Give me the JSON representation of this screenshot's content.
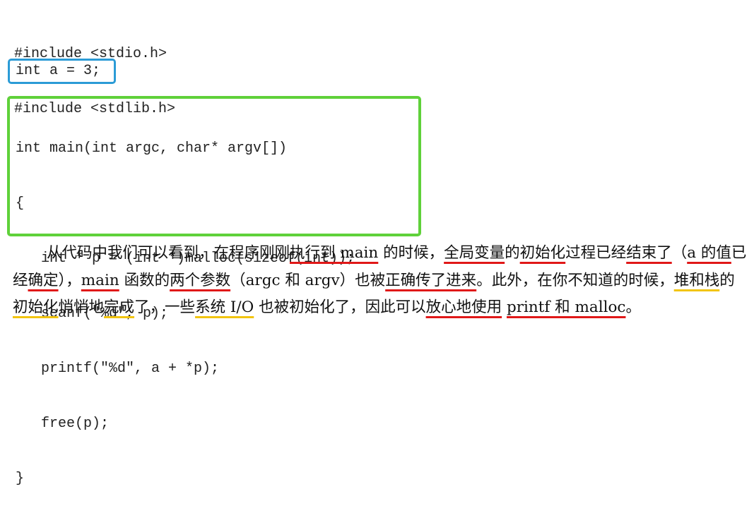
{
  "code": {
    "include_lines": [
      "#include <stdio.h>",
      "#include <stdlib.h>"
    ],
    "global_decl": "int a = 3;",
    "main_lines": [
      "int main(int argc, char* argv[])",
      "{",
      "   int * p = (int *)malloc(sizeof(int));",
      "   scanf(\"%d\", p);",
      "   printf(\"%d\", a + *p);",
      "   free(p);",
      "}"
    ]
  },
  "paragraph": {
    "segments": [
      {
        "text": "从代码中我们可以看到，在程序刚刚",
        "style": "plain"
      },
      {
        "text": "执行到 main",
        "style": "red"
      },
      {
        "text": " 的时候，",
        "style": "plain"
      },
      {
        "text": "全局变量",
        "style": "red"
      },
      {
        "text": "的",
        "style": "plain"
      },
      {
        "text": "初始化",
        "style": "red"
      },
      {
        "text": "过程已经",
        "style": "plain"
      },
      {
        "text": "结束了",
        "style": "red"
      },
      {
        "text": "（",
        "style": "plain"
      },
      {
        "text": "a 的值",
        "style": "red"
      },
      {
        "text": "已经",
        "style": "plain"
      },
      {
        "text": "确定",
        "style": "red"
      },
      {
        "text": "），",
        "style": "plain"
      },
      {
        "text": "main",
        "style": "red"
      },
      {
        "text": " 函数的",
        "style": "plain"
      },
      {
        "text": "两个参数",
        "style": "red"
      },
      {
        "text": "（argc 和 argv）也被",
        "style": "plain"
      },
      {
        "text": "正确传了进来",
        "style": "red"
      },
      {
        "text": "。此外，在你不知道的时候，",
        "style": "plain"
      },
      {
        "text": "堆和栈",
        "style": "yellow"
      },
      {
        "text": "的",
        "style": "plain"
      },
      {
        "text": "初始化",
        "style": "yellow"
      },
      {
        "text": "悄悄地",
        "style": "plain"
      },
      {
        "text": "完成",
        "style": "yellow"
      },
      {
        "text": "了，一些",
        "style": "plain"
      },
      {
        "text": "系统 I/O",
        "style": "yellow"
      },
      {
        "text": " 也被初始化了，因此可以",
        "style": "plain"
      },
      {
        "text": "放心地使用",
        "style": "red"
      },
      {
        "text": " ",
        "style": "plain"
      },
      {
        "text": "printf 和 malloc",
        "style": "red"
      },
      {
        "text": "。",
        "style": "plain"
      }
    ]
  },
  "colors": {
    "blue_box": "#2b9bd6",
    "green_box": "#5fd13a",
    "red_underline": "#e01818",
    "yellow_underline": "#f2c40f"
  }
}
